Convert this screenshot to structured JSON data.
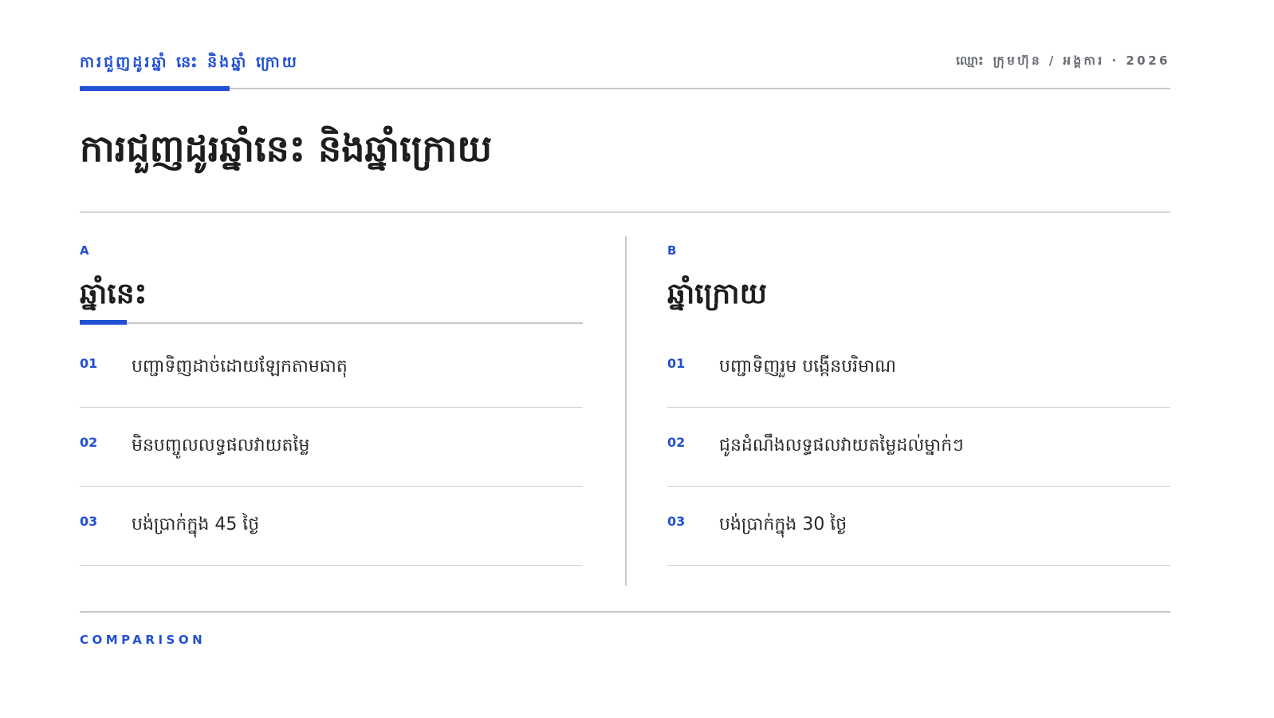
{
  "header": {
    "kicker": "ការជួញដូរឆ្នាំ នេះ និងឆ្នាំ ក្រោយ",
    "meta": "ឈ្មោះ ក្រុមហ៊ុន / អង្គការ · 2026"
  },
  "title": "ការជួញដូរឆ្នាំនេះ និងឆ្នាំក្រោយ",
  "columns": [
    {
      "letter": "A",
      "heading": "ឆ្នាំនេះ",
      "items": [
        {
          "num": "01",
          "text": "បញ្ជាទិញដាច់ដោយឡែកតាមធាតុ"
        },
        {
          "num": "02",
          "text": "មិនបញ្ចូលលទ្ធផលវាយតម្លៃ"
        },
        {
          "num": "03",
          "text": "បង់ប្រាក់ក្នុង 45 ថ្ងៃ"
        }
      ]
    },
    {
      "letter": "B",
      "heading": "ឆ្នាំក្រោយ",
      "items": [
        {
          "num": "01",
          "text": "បញ្ជាទិញរួម បង្កើនបរិមាណ"
        },
        {
          "num": "02",
          "text": "ជូនដំណឹងលទ្ធផលវាយតម្លៃដល់ម្នាក់ៗ"
        },
        {
          "num": "03",
          "text": "បង់ប្រាក់ក្នុង 30 ថ្ងៃ"
        }
      ]
    }
  ],
  "footer": {
    "label": "COMPARISON"
  },
  "colors": {
    "accent": "#2250d4",
    "text": "#1e1e1e",
    "rule": "#c8c8c8"
  }
}
